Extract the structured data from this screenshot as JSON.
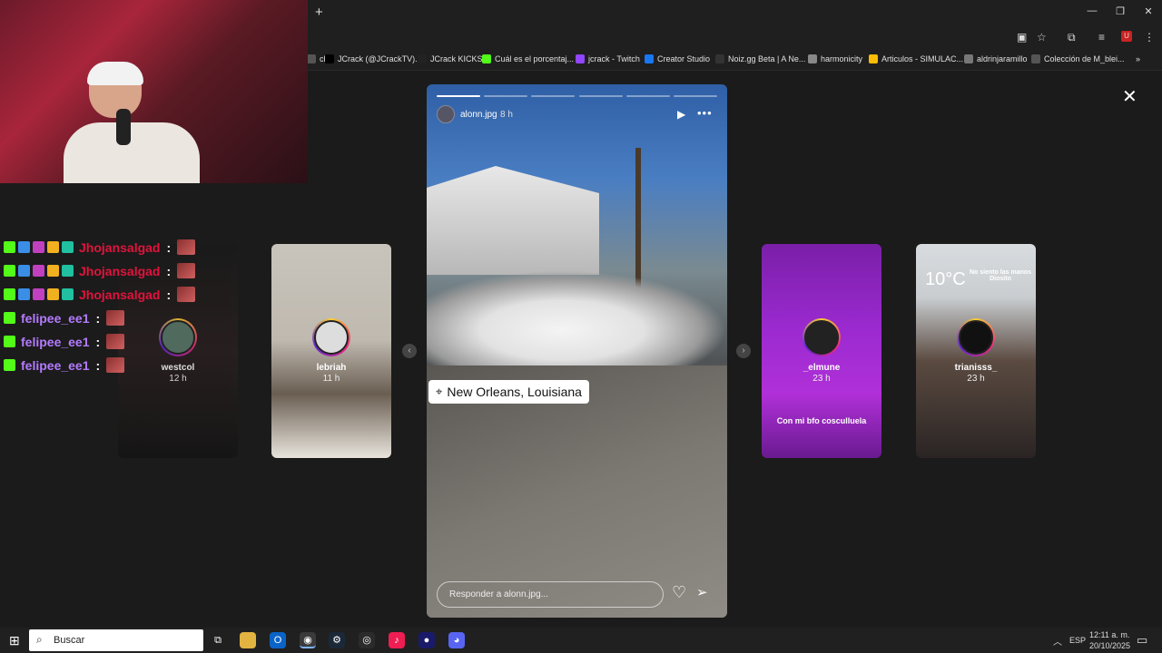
{
  "browser": {
    "new_tab": "+",
    "bookmarks": [
      {
        "label": "ch",
        "color": "#555"
      },
      {
        "label": "JCrack (@JCrackTV)...",
        "color": "#000"
      },
      {
        "label": "JCrack KICKS",
        "color": "#222"
      },
      {
        "label": "Cuál es el porcentaj...",
        "color": "#53fc18"
      },
      {
        "label": "jcrack - Twitch",
        "color": "#9146ff"
      },
      {
        "label": "Creator Studio",
        "color": "#1877f2"
      },
      {
        "label": "Noiz.gg Beta | A Ne...",
        "color": "#333"
      },
      {
        "label": "harmonicity",
        "color": "#888"
      },
      {
        "label": "Articulos - SIMULAC...",
        "color": "#fbbc04"
      },
      {
        "label": "aldrinjaramillo",
        "color": "#777"
      },
      {
        "label": "Colección de M_blei...",
        "color": "#555"
      }
    ],
    "more_bookmarks": "»"
  },
  "chat": [
    {
      "user": "Jhojansalgad",
      "sep": ":",
      "color": "#e0143c"
    },
    {
      "user": "Jhojansalgad",
      "sep": ":",
      "color": "#e0143c"
    },
    {
      "user": "Jhojansalgad",
      "sep": ":",
      "color": "#e0143c"
    },
    {
      "user": "felipee_ee1",
      "sep": ":",
      "color": "#b57bff"
    },
    {
      "user": "felipee_ee1",
      "sep": ":",
      "color": "#b57bff"
    },
    {
      "user": "felipee_ee1",
      "sep": ":",
      "color": "#b57bff"
    }
  ],
  "stories": {
    "left": [
      {
        "username": "westcol",
        "time": "12 h"
      },
      {
        "username": "lebriah",
        "time": "11 h"
      }
    ],
    "right": [
      {
        "username": "_elmune",
        "time": "23 h",
        "caption": "Con mi bfo cosculluela"
      },
      {
        "username": "trianisss_",
        "time": "23 h",
        "temp": "10°C",
        "note": "No siento las manos Diosito"
      }
    ],
    "main": {
      "username": "alonn.jpg",
      "time": "8 h",
      "location": "New Orleans, Louisiana",
      "reply_placeholder": "Responder a alonn.jpg...",
      "progress_segments": 6,
      "progress_done": 1
    },
    "close": "✕"
  },
  "taskbar": {
    "search_placeholder": "Buscar",
    "lang": "ESP",
    "time": "12:11 a. m.",
    "date": "20/10/2025"
  }
}
